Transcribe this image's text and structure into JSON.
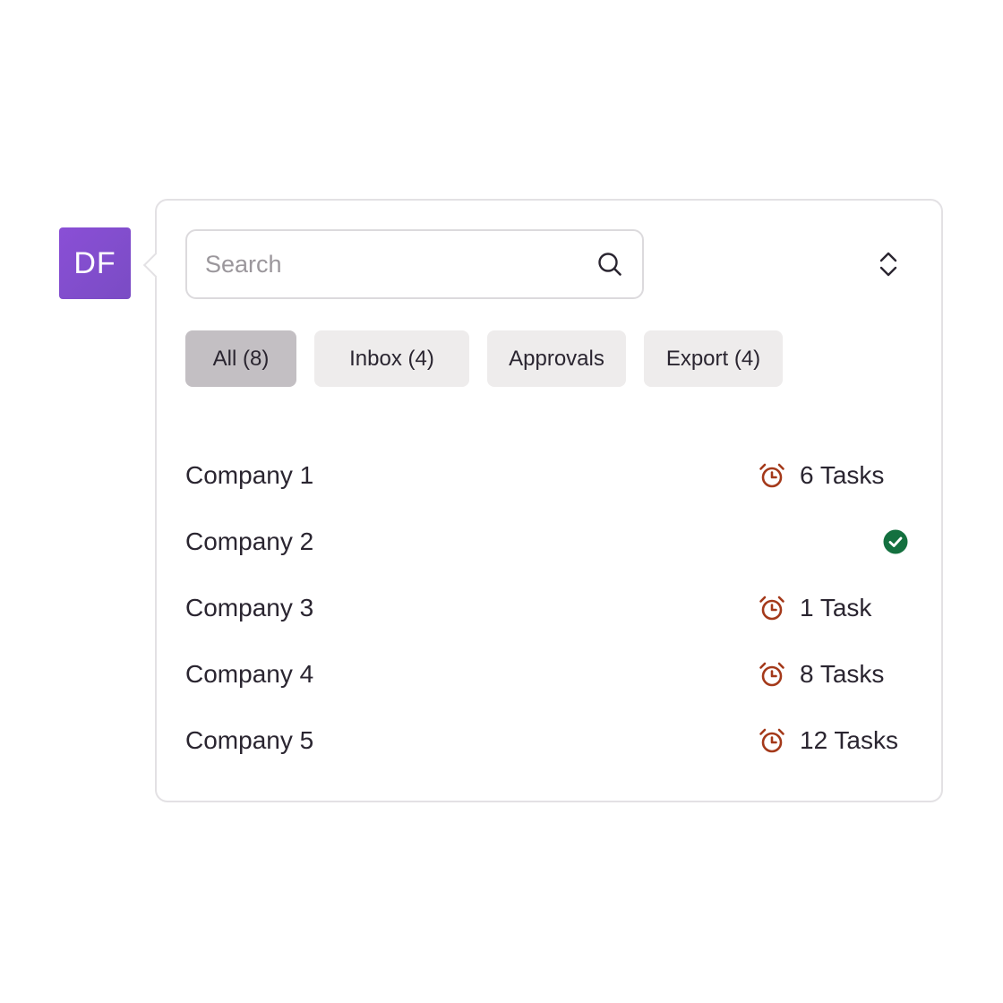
{
  "avatar": {
    "initials": "DF",
    "color": "#7e4dcc"
  },
  "search": {
    "placeholder": "Search",
    "value": ""
  },
  "filters": [
    {
      "label": "All (8)",
      "active": true
    },
    {
      "label": "Inbox (4)",
      "active": false
    },
    {
      "label": "Approvals",
      "active": false
    },
    {
      "label": "Export (4)",
      "active": false
    }
  ],
  "companies": [
    {
      "name": "Company 1",
      "status": "pending",
      "tasks": "6 Tasks",
      "icon": "alarm-clock-icon"
    },
    {
      "name": "Company 2",
      "status": "complete",
      "tasks": "",
      "icon": "check-circle-icon"
    },
    {
      "name": "Company 3",
      "status": "pending",
      "tasks": "1 Task",
      "icon": "alarm-clock-icon"
    },
    {
      "name": "Company 4",
      "status": "pending",
      "tasks": "8 Tasks",
      "icon": "alarm-clock-icon"
    },
    {
      "name": "Company 5",
      "status": "pending",
      "tasks": "12 Tasks",
      "icon": "alarm-clock-icon"
    }
  ],
  "colors": {
    "pending": "#a4391a",
    "complete": "#14703f",
    "chip_active": "#c3bfc3",
    "chip": "#eeecec"
  }
}
